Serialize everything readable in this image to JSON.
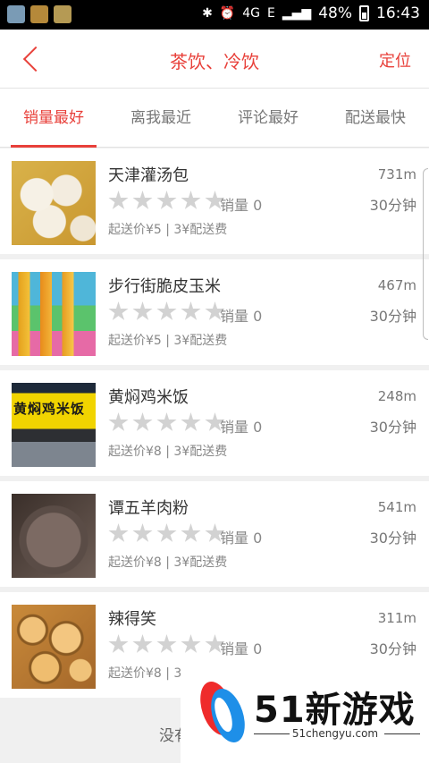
{
  "status_bar": {
    "network": "4G",
    "signal_label": "E",
    "battery": "48%",
    "time": "16:43"
  },
  "header": {
    "title": "茶饮、冷饮",
    "locate": "定位"
  },
  "tabs": [
    "销量最好",
    "离我最近",
    "评论最好",
    "配送最快"
  ],
  "items": [
    {
      "name": "天津灌汤包",
      "distance": "731m",
      "sales": "销量 0",
      "time": "30分钟",
      "price": "起送价¥5 | 3¥配送费"
    },
    {
      "name": "步行街脆皮玉米",
      "distance": "467m",
      "sales": "销量 0",
      "time": "30分钟",
      "price": "起送价¥5 | 3¥配送费"
    },
    {
      "name": "黄焖鸡米饭",
      "distance": "248m",
      "sales": "销量 0",
      "time": "30分钟",
      "price": "起送价¥8 | 3¥配送费"
    },
    {
      "name": "谭五羊肉粉",
      "distance": "541m",
      "sales": "销量 0",
      "time": "30分钟",
      "price": "起送价¥8 | 3¥配送费"
    },
    {
      "name": "辣得笑",
      "distance": "311m",
      "sales": "销量 0",
      "time": "30分钟",
      "price": "起送价¥8 | 3"
    }
  ],
  "footer": {
    "text": "没有"
  },
  "watermark": {
    "brand": "51新游戏",
    "url": "51chengyu.com"
  },
  "colors": {
    "accent": "#e8403a",
    "star": "#d2d2d2"
  }
}
